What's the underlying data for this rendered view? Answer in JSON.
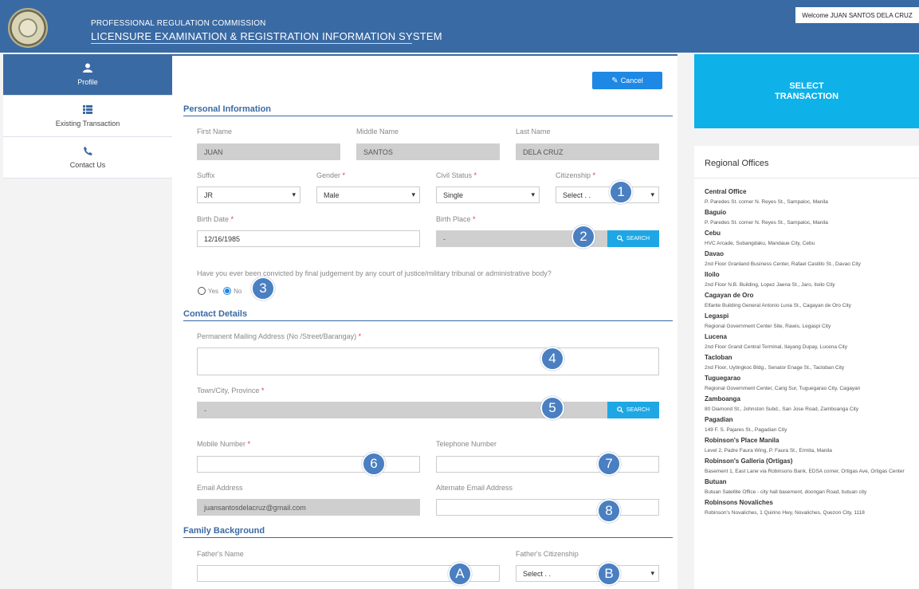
{
  "header": {
    "org": "PROFESSIONAL REGULATION COMMISSION",
    "system": "LICENSURE EXAMINATION & REGISTRATION INFORMATION SYSTEM",
    "welcome": "Welcome JUAN SANTOS DELA CRUZ"
  },
  "sidebar": {
    "items": [
      {
        "label": "Profile",
        "icon": "user-icon"
      },
      {
        "label": "Existing Transaction",
        "icon": "list-icon"
      },
      {
        "label": "Contact Us",
        "icon": "phone-icon"
      }
    ]
  },
  "form": {
    "cancel_label": "Cancel",
    "personal": {
      "title": "Personal Information",
      "first_name_label": "First Name",
      "first_name": "JUAN",
      "middle_name_label": "Middle Name",
      "middle_name": "SANTOS",
      "last_name_label": "Last Name",
      "last_name": "DELA CRUZ",
      "suffix_label": "Suffix",
      "suffix": "JR",
      "gender_label": "Gender",
      "gender": "Male",
      "civil_status_label": "Civil Status",
      "civil_status": "Single",
      "citizenship_label": "Citizenship",
      "citizenship": "Select . .",
      "birth_date_label": "Birth Date",
      "birth_date": "12/16/1985",
      "birth_place_label": "Birth Place",
      "birth_place": "-",
      "search_label": "SEARCH",
      "conviction_question": "Have you ever been convicted by final judgement by any court of justice/military tribunal or administrative body?",
      "yes_label": "Yes",
      "no_label": "No"
    },
    "contact": {
      "title": "Contact Details",
      "address_label": "Permanent Mailing Address (No /Street/Barangay)",
      "town_label": "Town/City, Province",
      "town": "-",
      "search_label": "SEARCH",
      "mobile_label": "Mobile Number",
      "telephone_label": "Telephone Number",
      "email_label": "Email Address",
      "email": "juansantosdelacruz@gmail.com",
      "alt_email_label": "Alternate Email Address"
    },
    "family": {
      "title": "Family Background",
      "father_name_label": "Father's Name",
      "father_citizenship_label": "Father's Citizenship",
      "father_citizenship": "Select . ."
    },
    "required_mark": "*"
  },
  "badges": [
    "1",
    "2",
    "3",
    "4",
    "5",
    "6",
    "7",
    "8",
    "A",
    "B"
  ],
  "right": {
    "select_transaction": "SELECT TRANSACTION",
    "regional_title": "Regional Offices",
    "offices": [
      {
        "name": "Central Office",
        "address": "P. Paredes St. corner N. Reyes St., Sampaloc, Manila"
      },
      {
        "name": "Baguio",
        "address": "P. Paredes St. corner N. Reyes St., Sampaloc, Manila"
      },
      {
        "name": "Cebu",
        "address": "HVC Arcade, Subangdaku, Mandaue City, Cebu"
      },
      {
        "name": "Davao",
        "address": "2nd Floor Granland Business Center, Rafael Castillo St., Davao City"
      },
      {
        "name": "Iloilo",
        "address": "2nd Floor N.B. Building, Lopez Jaena St., Jaro, Iloilo City"
      },
      {
        "name": "Cagayan de Oro",
        "address": "Elfante Building General Antonio Luna St., Cagayan de Oro City"
      },
      {
        "name": "Legaspi",
        "address": "Regional Government Center Site, Rawis, Legaspi City"
      },
      {
        "name": "Lucena",
        "address": "2nd Floor Grand Central Terminal, Ilayang Dupay, Lucena City"
      },
      {
        "name": "Tacloban",
        "address": "2nd Floor, Uytingkoc Bldg., Senator Enage St., Tacloban City"
      },
      {
        "name": "Tuguegarao",
        "address": "Regional Government Center, Carig Sur, Tuguegarao City, Cagayan"
      },
      {
        "name": "Zamboanga",
        "address": "80 Diamond St., Johnston Subd., San Jose Road, Zamboanga City"
      },
      {
        "name": "Pagadian",
        "address": "149 F. S. Pajares St., Pagadian City"
      },
      {
        "name": "Robinson's Place Manila",
        "address": "Level 2, Padre Faura Wing, P. Faura St., Ermita, Manila"
      },
      {
        "name": "Robinson's Galleria (Ortigas)",
        "address": "Basement 1, East Lane via Robinsons Bank, EDSA corner, Ortigas Ave, Ortigas Center"
      },
      {
        "name": "Butuan",
        "address": "Butuan Satellite Office - city hall basement, doongan Road, butuan city"
      },
      {
        "name": "Robinsons Novaliches",
        "address": "Robinson's Novaliches, 1 Quirino Hwy, Novaliches, Quezon City, 1118"
      }
    ]
  }
}
